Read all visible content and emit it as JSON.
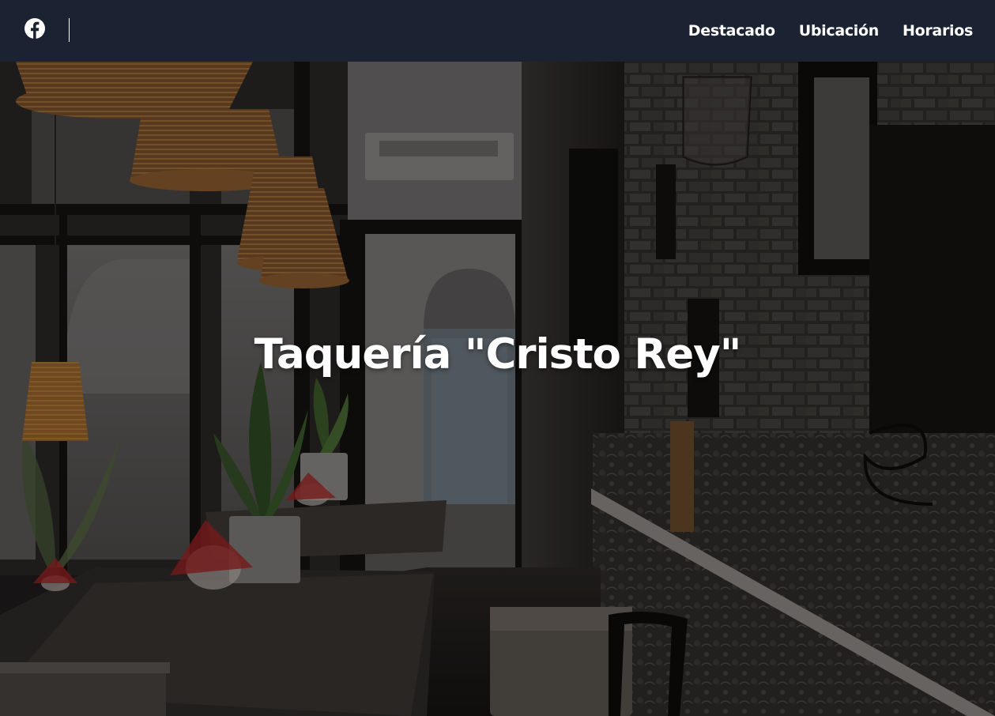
{
  "header": {
    "social_icon": "facebook-icon",
    "nav": [
      {
        "label": "Destacado"
      },
      {
        "label": "Ubicación"
      },
      {
        "label": "Horarios"
      }
    ]
  },
  "hero": {
    "title": "Taquería \"Cristo Rey\""
  },
  "colors": {
    "navbar_bg": "#1b2232",
    "text": "#ffffff"
  }
}
